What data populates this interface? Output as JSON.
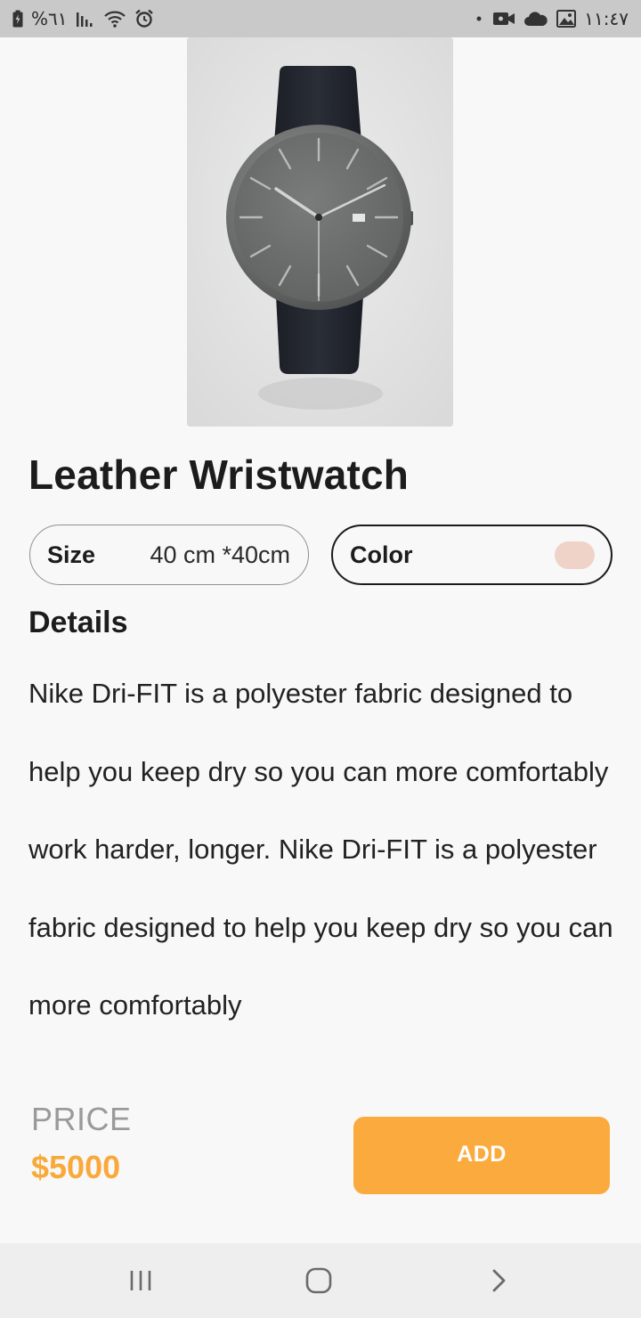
{
  "status_bar": {
    "battery_percent": "%٦١",
    "time": "١١:٤٧",
    "left_icons": [
      "battery-charging-icon",
      "signal-icon",
      "wifi-icon",
      "alarm-icon"
    ],
    "right_icons": [
      "notification-dot-icon",
      "video-icon",
      "cloud-icon",
      "image-icon"
    ]
  },
  "product": {
    "image_icon": "wristwatch-image",
    "title": "Leather Wristwatch",
    "size": {
      "label": "Size",
      "value": "40 cm *40cm"
    },
    "color": {
      "label": "Color",
      "swatch": "#efd3c9"
    },
    "details_heading": "Details",
    "details_text": "Nike Dri-FIT is a polyester fabric designed to help you keep dry so you can more comfortably work harder, longer. Nike Dri-FIT is a polyester fabric designed to help you keep dry so you can more comfortably"
  },
  "purchase": {
    "price_label": "PRICE",
    "price_value": "$5000",
    "add_label": "ADD"
  },
  "nav_bar": {
    "icons": [
      "recent-apps-icon",
      "home-icon",
      "back-icon"
    ]
  },
  "colors": {
    "accent": "#fbab3e",
    "price": "#f9a93a",
    "status_bar_bg": "#c9c9c9",
    "nav_bar_bg": "#eeeeee",
    "background": "#f8f8f8"
  }
}
